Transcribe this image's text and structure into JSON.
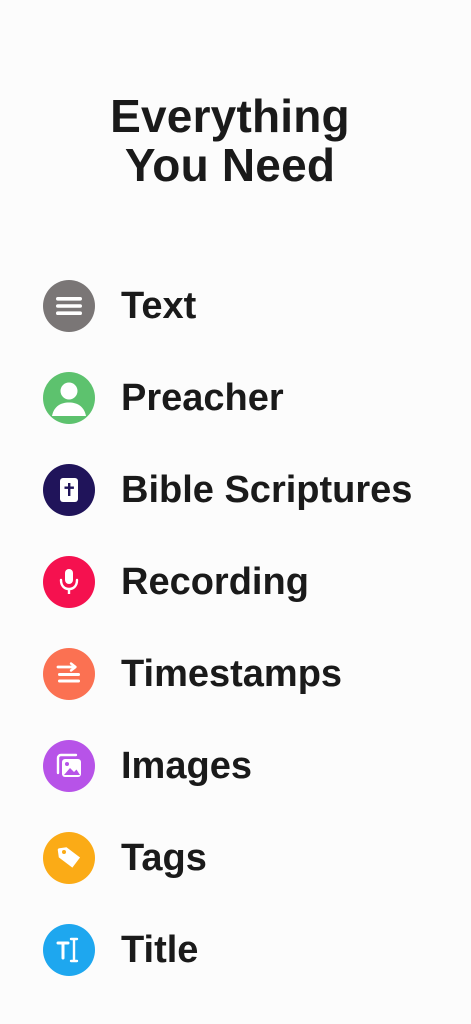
{
  "header": {
    "title_line1": "Everything",
    "title_line2": "You Need"
  },
  "features": [
    {
      "label": "Text",
      "icon": "text-lines-icon",
      "color": "#7a7676"
    },
    {
      "label": "Preacher",
      "icon": "person-icon",
      "color": "#5dc26e"
    },
    {
      "label": "Bible Scriptures",
      "icon": "bible-cross-icon",
      "color": "#20145a"
    },
    {
      "label": "Recording",
      "icon": "microphone-icon",
      "color": "#f5114f"
    },
    {
      "label": "Timestamps",
      "icon": "timestamps-icon",
      "color": "#fb7152"
    },
    {
      "label": "Images",
      "icon": "images-icon",
      "color": "#b753e8"
    },
    {
      "label": "Tags",
      "icon": "tags-icon",
      "color": "#fbab16"
    },
    {
      "label": "Title",
      "icon": "title-text-icon",
      "color": "#1ea7ef"
    }
  ]
}
